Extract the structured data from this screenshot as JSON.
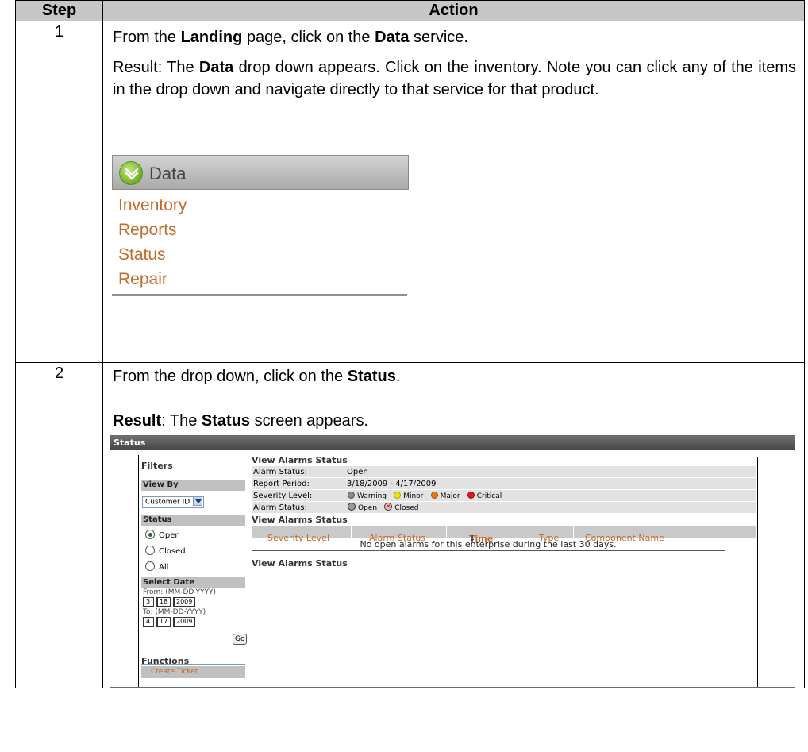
{
  "table": {
    "header_step": "Step",
    "header_action": "Action"
  },
  "step1": {
    "number": "1",
    "line1_pre": "From the ",
    "line1_bold1": "Landing",
    "line1_mid": " page, click on the ",
    "line1_bold2": "Data",
    "line1_post": " service.",
    "result_pre": "Result:  The ",
    "result_bold": "Data",
    "result_post": " drop down appears.  Click on the inventory.  Note you can click any of the items in the drop down and navigate directly to that service for that product."
  },
  "data_menu": {
    "title": "Data",
    "items": [
      "Inventory",
      "Reports",
      "Status",
      "Repair"
    ],
    "item_color": "#c46a2b",
    "logo_icon": "chevron-down-circle-icon"
  },
  "step2": {
    "number": "2",
    "line1_pre": "From the drop down, click on the ",
    "line1_bold": "Status",
    "line1_post": ".",
    "result_bold1": "Result",
    "result_mid": ":  The ",
    "result_bold2": "Status",
    "result_post": " screen appears."
  },
  "status_screen": {
    "title": "Status",
    "filters_title": "Filters",
    "view_by_header": "View By",
    "view_by_value": "Customer ID",
    "status_header": "Status",
    "status_options": [
      {
        "label": "Open",
        "selected": true
      },
      {
        "label": "Closed",
        "selected": false
      },
      {
        "label": "All",
        "selected": false
      }
    ],
    "select_date_header": "Select Date",
    "from_label": "From: (MM-DD-YYYY)",
    "from_month": "3",
    "from_day": "18",
    "from_year": "2009",
    "to_label": "To: (MM-DD-YYYY)",
    "to_month": "4",
    "to_day": "17",
    "to_year": "2009",
    "go_label": "Go",
    "functions_title": "Functions",
    "create_ticket": "Create Ticket",
    "view_alarms_title": "View Alarms Status",
    "alarm_status_label": "Alarm Status:",
    "alarm_status_value": "Open",
    "report_period_label": "Report Period:",
    "report_period_value": "3/18/2009 - 4/17/2009",
    "severity_label": "Severity Level:",
    "severity_levels": [
      {
        "label": "Warning",
        "color": "#8a8a8a"
      },
      {
        "label": "Minor",
        "color": "#f2e200"
      },
      {
        "label": "Major",
        "color": "#e87817"
      },
      {
        "label": "Critical",
        "color": "#e8141b"
      }
    ],
    "alarm_status2_label": "Alarm Status:",
    "alarm_open": "Open",
    "alarm_closed": "Closed",
    "view_alarms_title2": "View Alarms Status",
    "columns": [
      "Severity Level",
      "Alarm Status",
      "Time",
      "Type",
      "Component Name"
    ],
    "sort_indicator": "↓",
    "empty_message": "No open alarms for this enterprise during the last 30 days.",
    "view_alarms_title3": "View Alarms Status"
  }
}
